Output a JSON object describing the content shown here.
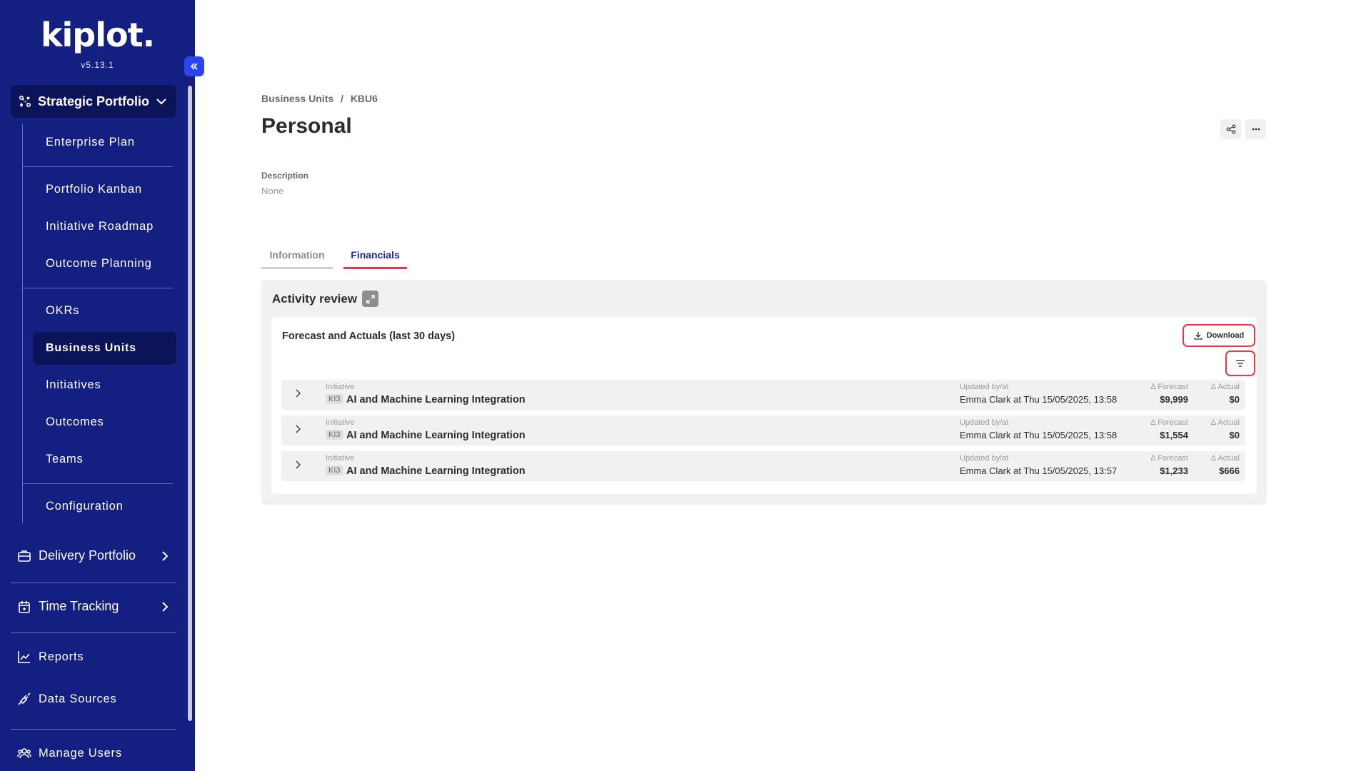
{
  "sidebar": {
    "logo": "kiplot.",
    "version": "v5.13.1",
    "strategic_portfolio": "Strategic Portfolio",
    "sub_items": [
      {
        "label": "Enterprise Plan"
      },
      {
        "label": "Portfolio Kanban"
      },
      {
        "label": "Initiative Roadmap"
      },
      {
        "label": "Outcome Planning"
      },
      {
        "label": "OKRs"
      },
      {
        "label": "Business Units"
      },
      {
        "label": "Initiatives"
      },
      {
        "label": "Outcomes"
      },
      {
        "label": "Teams"
      },
      {
        "label": "Configuration"
      }
    ],
    "active_item": "Business Units",
    "delivery_portfolio": "Delivery Portfolio",
    "time_tracking": "Time Tracking",
    "reports": "Reports",
    "data_sources": "Data Sources",
    "manage_users": "Manage Users"
  },
  "breadcrumb": {
    "parent": "Business Units",
    "separator": "/",
    "current": "KBU6"
  },
  "page": {
    "title": "Personal",
    "description_label": "Description",
    "description_value": "None"
  },
  "tabs": [
    {
      "label": "Information",
      "active": false
    },
    {
      "label": "Financials",
      "active": true
    }
  ],
  "activity_review": {
    "title": "Activity review",
    "card_title": "Forecast and Actuals (last 30 days)",
    "download_label": "Download",
    "rows": [
      {
        "type": "Initiative",
        "key": "KI3",
        "name": "AI and Machine Learning Integration",
        "updated_label": "Updated by/at",
        "updated_value": "Emma Clark at Thu 15/05/2025, 13:58",
        "forecast_label": "Δ Forecast",
        "forecast": "$9,999",
        "actual_label": "Δ Actual",
        "actual": "$0"
      },
      {
        "type": "Initiative",
        "key": "KI3",
        "name": "AI and Machine Learning Integration",
        "updated_label": "Updated by/at",
        "updated_value": "Emma Clark at Thu 15/05/2025, 13:58",
        "forecast_label": "Δ Forecast",
        "forecast": "$1,554",
        "actual_label": "Δ Actual",
        "actual": "$0"
      },
      {
        "type": "Initiative",
        "key": "KI3",
        "name": "AI and Machine Learning Integration",
        "updated_label": "Updated by/at",
        "updated_value": "Emma Clark at Thu 15/05/2025, 13:57",
        "forecast_label": "Δ Forecast",
        "forecast": "$1,233",
        "actual_label": "Δ Actual",
        "actual": "$666"
      }
    ]
  },
  "colors": {
    "sidebar_bg": "#141f82",
    "sidebar_active": "#0b1458",
    "accent": "#2b46f0",
    "highlight": "#e63a4a",
    "tab_active_text": "#1a2ab0"
  }
}
